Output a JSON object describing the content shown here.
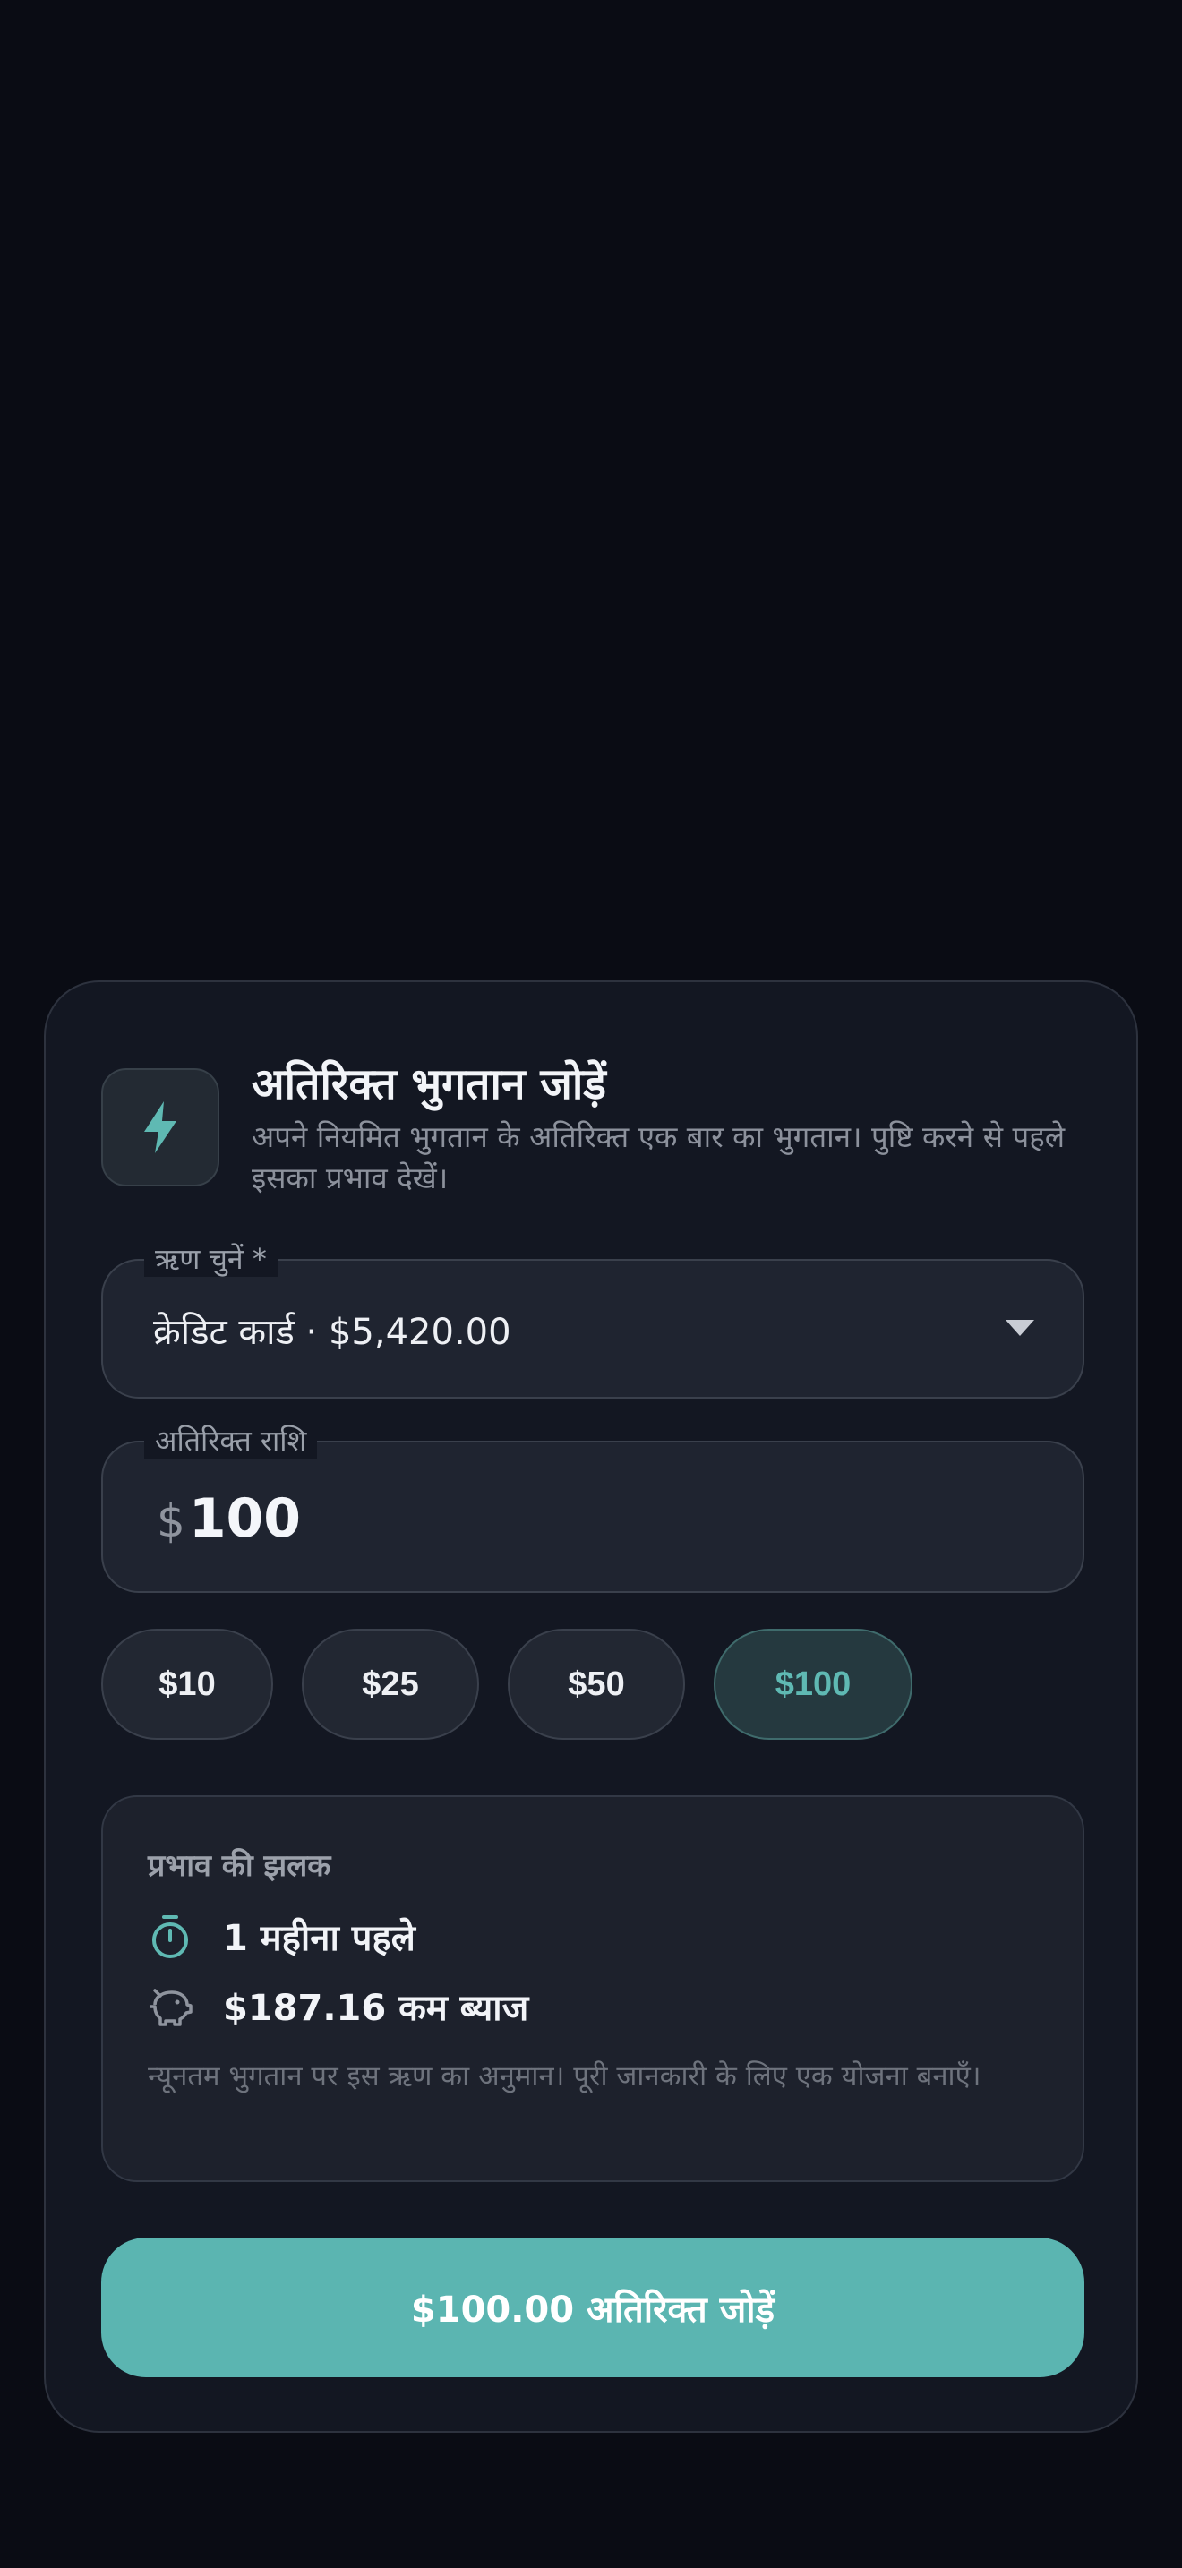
{
  "header": {
    "icon": "lightning-bolt-icon",
    "title": "अतिरिक्त भुगतान जोड़ें",
    "subtitle": "अपने नियमित भुगतान के अतिरिक्त एक बार का भुगतान। पुष्टि करने से पहले इसका प्रभाव देखें।"
  },
  "loan_select": {
    "label": "ऋण चुनें *",
    "selected": "क्रेडिट कार्ड · $5,420.00"
  },
  "amount": {
    "label": "अतिरिक्त राशि",
    "currency": "$",
    "value": "100"
  },
  "quick_amounts": [
    {
      "label": "$10",
      "selected": false
    },
    {
      "label": "$25",
      "selected": false
    },
    {
      "label": "$50",
      "selected": false
    },
    {
      "label": "$100",
      "selected": true
    }
  ],
  "impact_preview": {
    "title": "प्रभाव की झलक",
    "time_saved": "1 महीना पहले",
    "interest_saved": "$187.16 कम ब्याज",
    "note": "न्यूनतम भुगतान पर इस ऋण का अनुमान। पूरी जानकारी के लिए एक योजना बनाएँ।"
  },
  "submit_label": "$100.00 अतिरिक्त जोड़ें",
  "colors": {
    "accent": "#5bb5b1",
    "background": "#0a0c14",
    "card": "#131722"
  }
}
